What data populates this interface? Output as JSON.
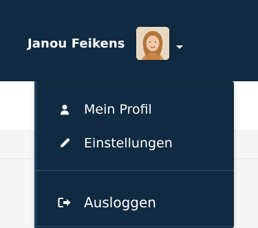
{
  "header": {
    "user_name": "Janou Feikens",
    "avatar_icon": "avatar-photo",
    "caret_icon": "chevron-down-icon"
  },
  "dropdown": {
    "items": [
      {
        "label": "Mein Profil",
        "icon": "user-icon"
      },
      {
        "label": "Einstellungen",
        "icon": "pencil-icon"
      },
      {
        "label": "Ausloggen",
        "icon": "sign-out-icon"
      }
    ]
  },
  "colors": {
    "header_bg": "#0f2a41",
    "dropdown_bg": "#0f2a41",
    "text": "#ffffff",
    "content_bg": "#f5f5f6"
  }
}
